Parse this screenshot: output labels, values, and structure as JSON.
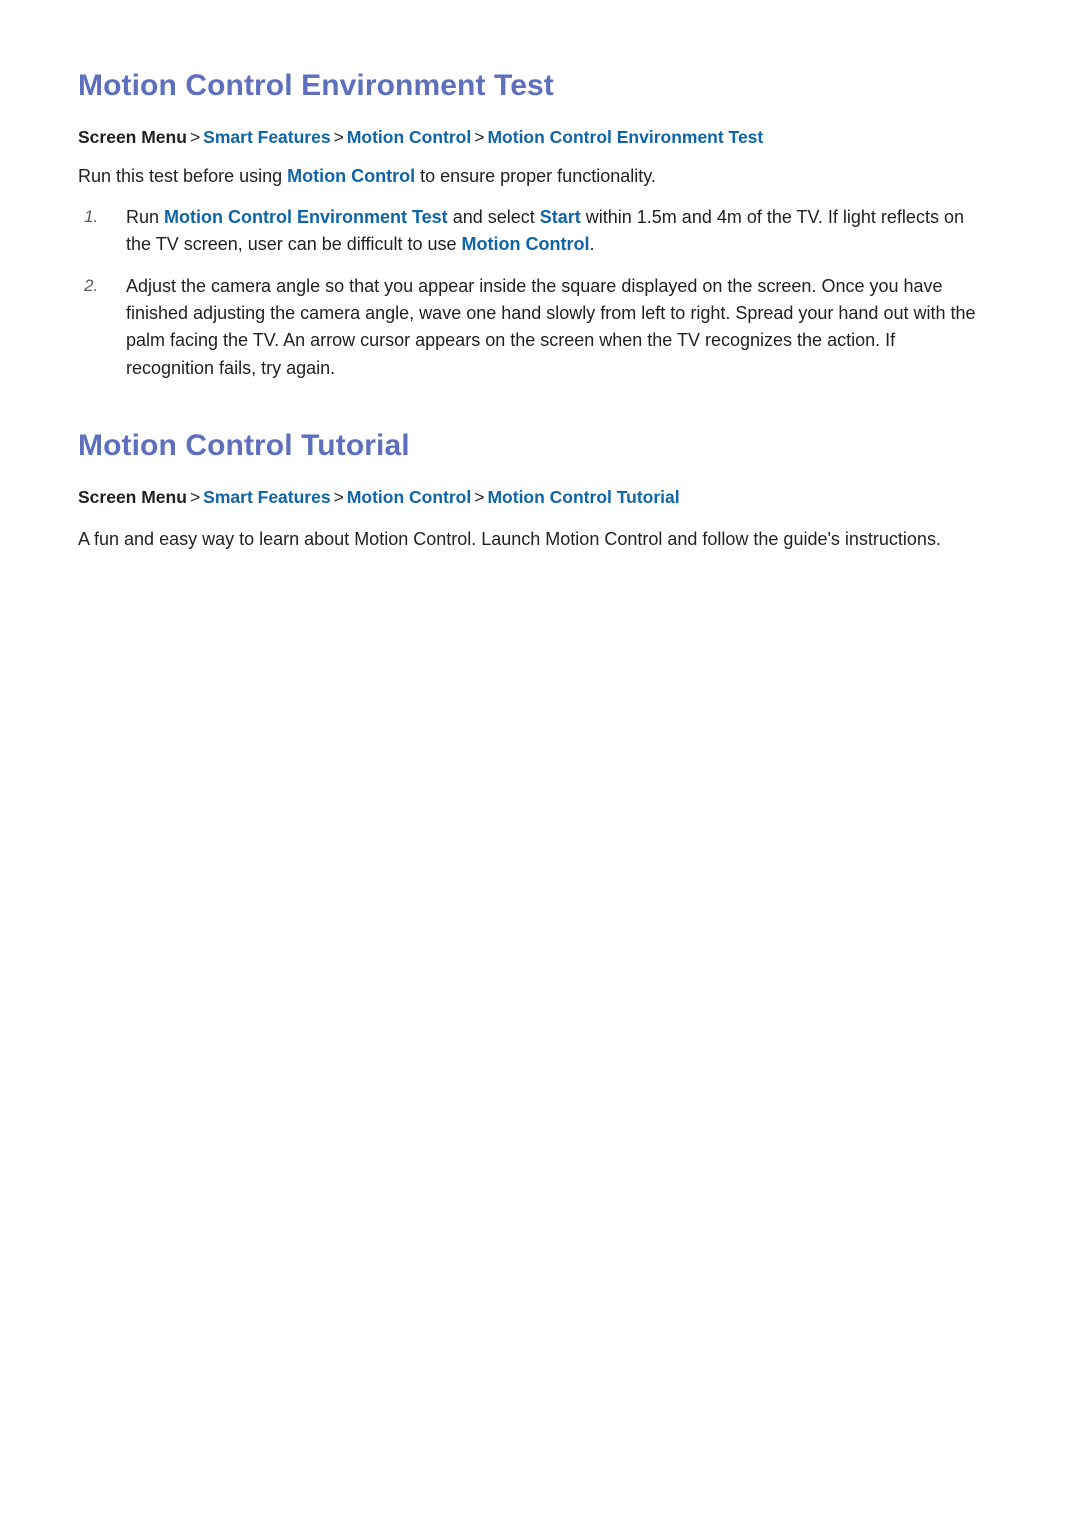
{
  "page": {
    "background": "#ffffff",
    "heading_color": "#5e6fbe",
    "link_color": "#1064a8",
    "text_color": "#231f20",
    "separator": ">"
  },
  "sections": [
    {
      "heading": "Motion Control Environment Test",
      "breadcrumb": {
        "root": "Screen Menu",
        "links": [
          "Smart Features",
          "Motion Control",
          "Motion Control Environment Test"
        ]
      },
      "intro": {
        "before": "Run this test before using ",
        "link": "Motion Control",
        "after": " to ensure proper functionality."
      },
      "steps": [
        {
          "marker": "1.",
          "parts": [
            {
              "text": "Run ",
              "style": "plain"
            },
            {
              "text": "Motion Control Environment Test",
              "style": "link"
            },
            {
              "text": " and select ",
              "style": "plain"
            },
            {
              "text": "Start",
              "style": "link"
            },
            {
              "text": " within 1.5m and 4m of the TV. If light reflects on the TV screen, user can be difficult to use ",
              "style": "plain"
            },
            {
              "text": "Motion Control",
              "style": "link"
            },
            {
              "text": ".",
              "style": "plain"
            }
          ]
        },
        {
          "marker": "2.",
          "parts": [
            {
              "text": "Adjust the camera angle so that you appear inside the square displayed on the screen. Once you have finished adjusting the camera angle, wave one hand slowly from left to right. Spread your hand out with the palm facing the TV. An arrow cursor appears on the screen when the TV recognizes the action. If recognition fails, try again.",
              "style": "plain"
            }
          ]
        }
      ]
    },
    {
      "heading": "Motion Control Tutorial",
      "breadcrumb": {
        "root": "Screen Menu",
        "links": [
          "Smart Features",
          "Motion Control",
          "Motion Control Tutorial"
        ]
      },
      "intro": {
        "before": "A fun and easy way to learn about Motion Control. Launch Motion Control and follow the guide's instructions.",
        "link": "",
        "after": ""
      },
      "steps": []
    }
  ]
}
